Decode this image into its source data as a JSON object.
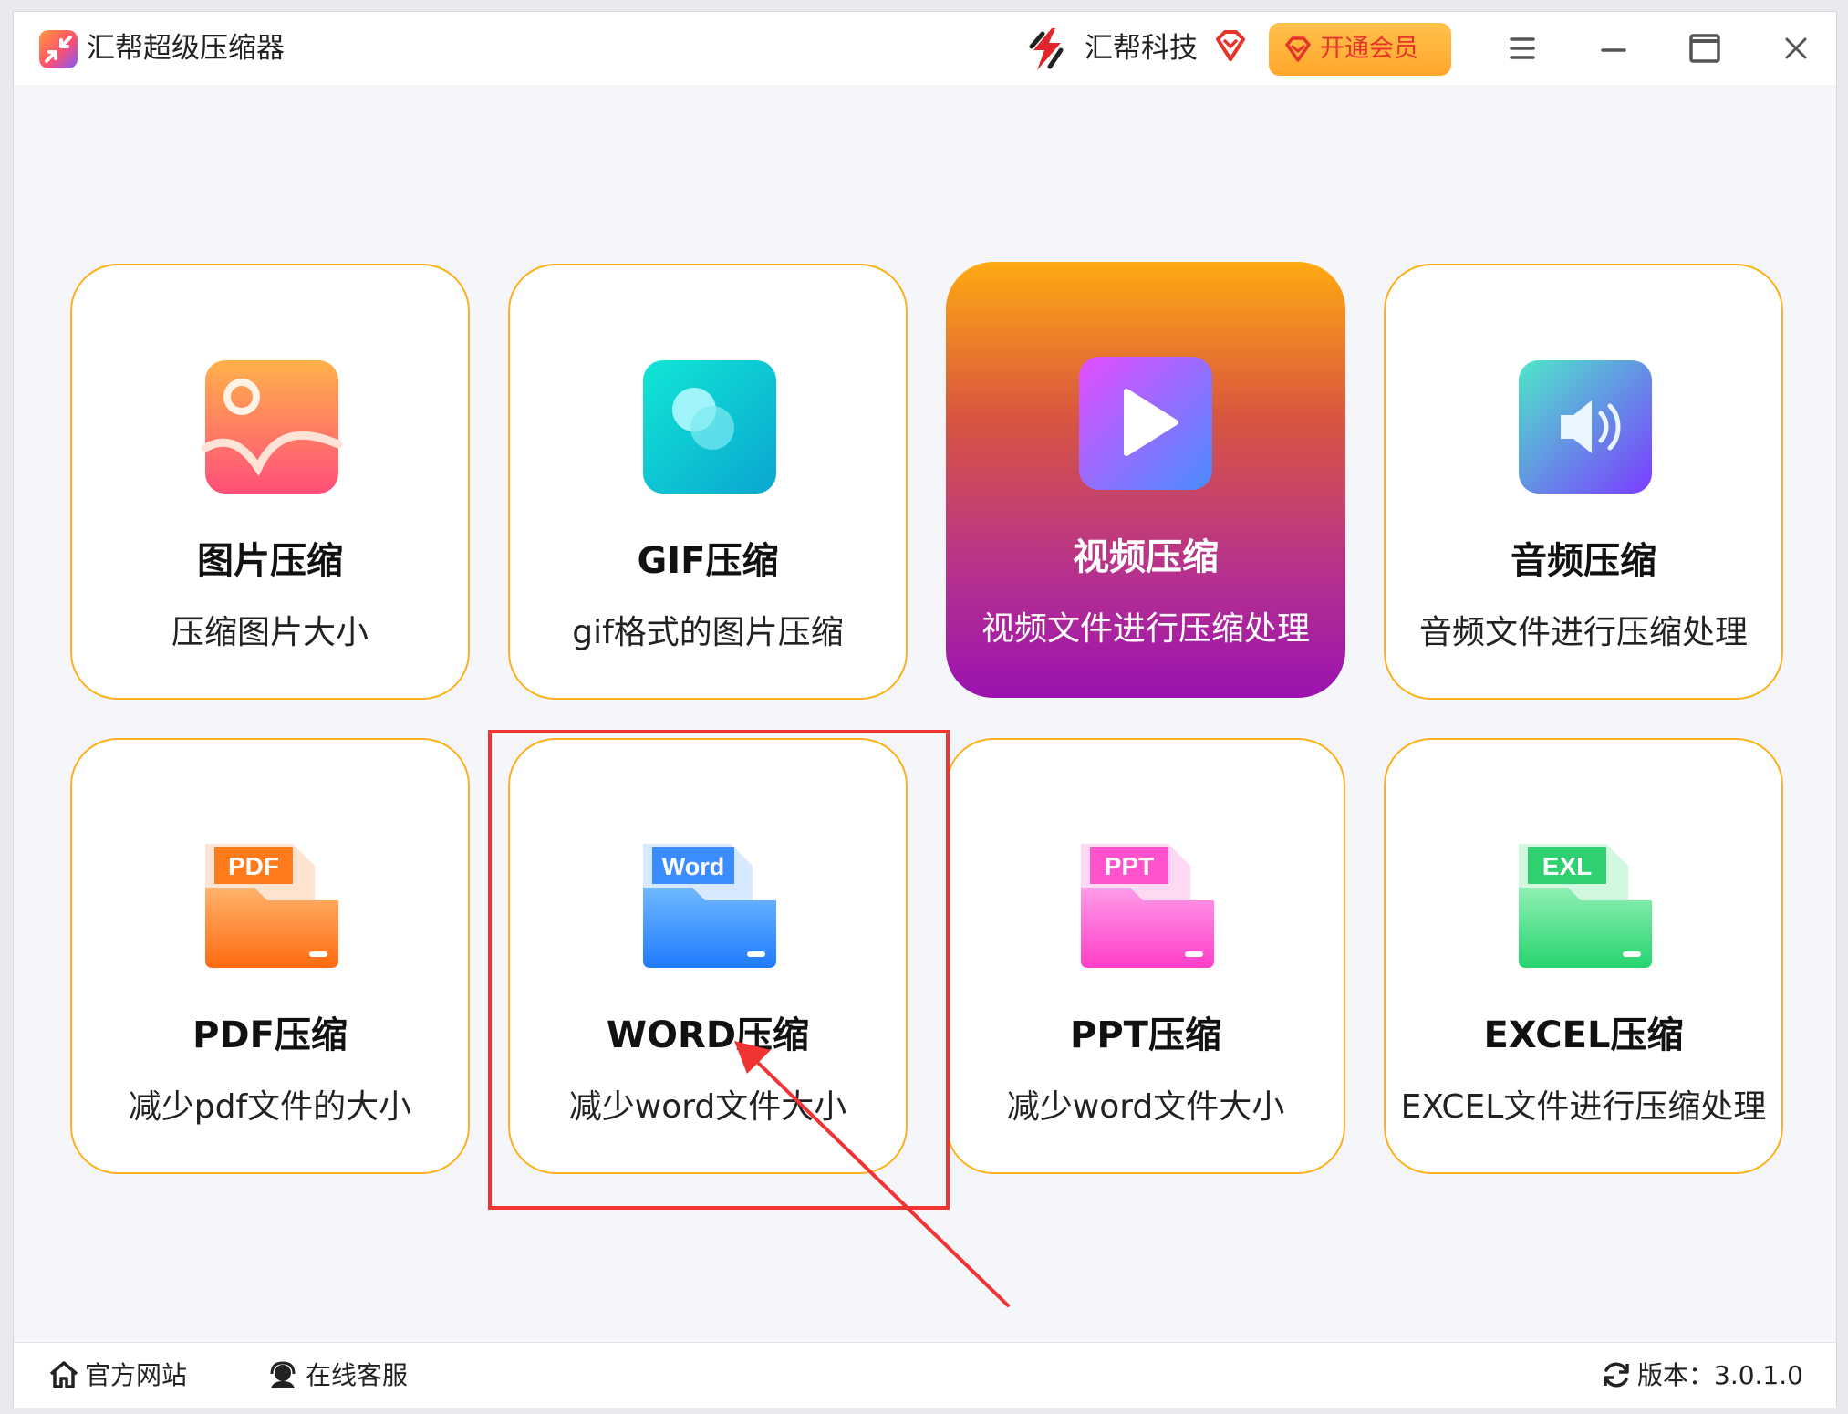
{
  "app": {
    "title": "汇帮超级压缩器"
  },
  "header": {
    "brand_name": "汇帮科技",
    "vip_label": "开通会员"
  },
  "cards": [
    {
      "title": "图片压缩",
      "desc": "压缩图片大小",
      "icon": "image-icon"
    },
    {
      "title": "GIF压缩",
      "desc": "gif格式的图片压缩",
      "icon": "gif-icon"
    },
    {
      "title": "视频压缩",
      "desc": "视频文件进行压缩处理",
      "icon": "video-play-icon",
      "active": true
    },
    {
      "title": "音频压缩",
      "desc": "音频文件进行压缩处理",
      "icon": "audio-speaker-icon"
    },
    {
      "title": "PDF压缩",
      "desc": "减少pdf文件的大小",
      "icon": "pdf-folder-icon",
      "tag": "PDF"
    },
    {
      "title": "WORD压缩",
      "desc": "减少word文件大小",
      "icon": "word-folder-icon",
      "tag": "Word"
    },
    {
      "title": "PPT压缩",
      "desc": "减少word文件大小",
      "icon": "ppt-folder-icon",
      "tag": "PPT"
    },
    {
      "title": "EXCEL压缩",
      "desc": "EXCEL文件进行压缩处理",
      "icon": "excel-folder-icon",
      "tag": "EXL"
    }
  ],
  "footer": {
    "website_label": "官方网站",
    "support_label": "在线客服",
    "version_label": "版本：3.0.1.0"
  },
  "colors": {
    "card_border": "#ffb020",
    "active_gradient_top": "#ffaa12",
    "active_gradient_bottom": "#9b12b0",
    "annotation": "#f03434",
    "vip_text": "#e8332a"
  }
}
